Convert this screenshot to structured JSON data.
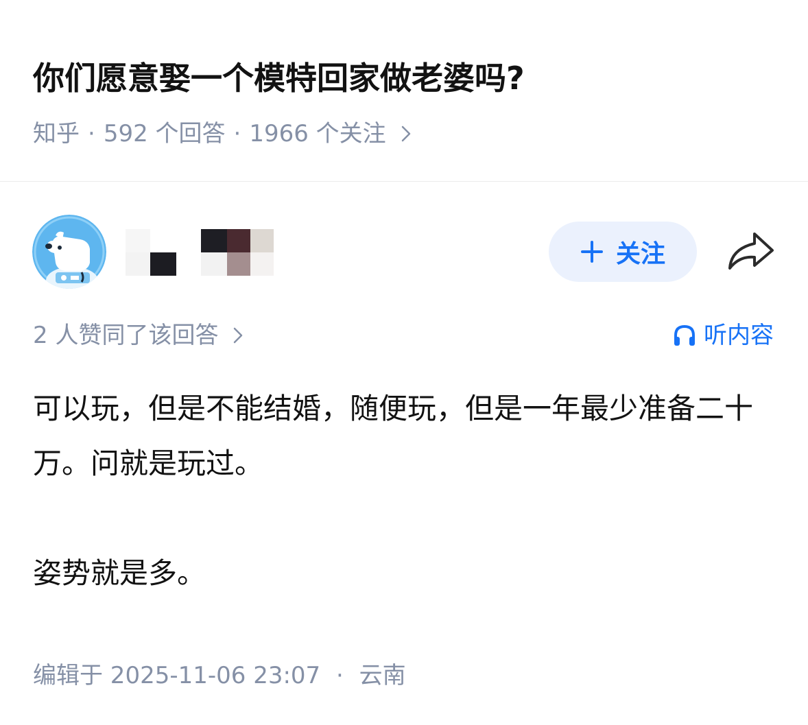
{
  "question": {
    "title": "你们愿意娶一个模特回家做老婆吗?",
    "source": "知乎",
    "answers": "592 个回答",
    "followers": "1966 个关注"
  },
  "author": {
    "follow_label": "关注"
  },
  "answer": {
    "voters": "2 人赞同了该回答",
    "listen_label": "听内容",
    "paragraphs": [
      "可以玩，但是不能结婚，随便玩，但是一年最少准备二十万。问就是玩过。",
      "姿势就是多。"
    ],
    "edit_label": "编辑于 2025-11-06 23:07",
    "location": "云南"
  },
  "colors": {
    "accent": "#1772f6",
    "follow_bg": "#ebf1fd",
    "muted": "#8590a6",
    "text": "#121212",
    "avatar_bg": "#5eb6ef"
  },
  "icons": [
    "chevron-right-icon",
    "plus-icon",
    "share-icon",
    "headphones-icon",
    "avatar-astronaut-icon"
  ]
}
